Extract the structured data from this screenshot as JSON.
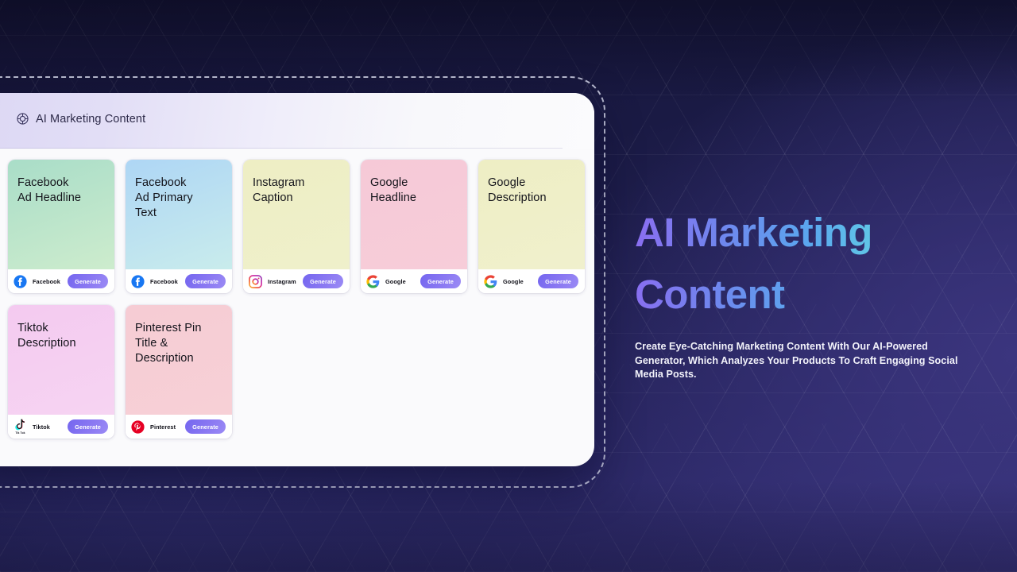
{
  "panel": {
    "header": {
      "icon": "target-circle-icon",
      "title": "AI Marketing Content"
    },
    "cards": [
      {
        "title": "Facebook\nAd Headline",
        "platform": "Facebook",
        "platform_icon": "facebook-icon",
        "button": "Generate",
        "swatch_from": "#a9ddc8",
        "swatch_to": "#cdeccd"
      },
      {
        "title": "Facebook\nAd Primary\nText",
        "platform": "Facebook",
        "platform_icon": "facebook-icon",
        "button": "Generate",
        "swatch_from": "#aed6f5",
        "swatch_to": "#c9ecec"
      },
      {
        "title": "Instagram\nCaption",
        "platform": "Instagram",
        "platform_icon": "instagram-icon",
        "button": "Generate",
        "swatch_from": "#eeeec4",
        "swatch_to": "#eff0cb"
      },
      {
        "title": "Google\nHeadline",
        "platform": "Google",
        "platform_icon": "google-icon",
        "button": "Generate",
        "swatch_from": "#f6c9d7",
        "swatch_to": "#f7cdd9"
      },
      {
        "title": "Google\nDescription",
        "platform": "Google",
        "platform_icon": "google-icon",
        "button": "Generate",
        "swatch_from": "#eeeec4",
        "swatch_to": "#f0f0cd"
      },
      {
        "title": "Tiktok\nDescription",
        "platform": "Tiktok",
        "platform_icon": "tiktok-icon",
        "button": "Generate",
        "swatch_from": "#f4caf0",
        "swatch_to": "#f6d4f2"
      },
      {
        "title": "Pinterest Pin\nTitle &\nDescription",
        "platform": "Pinterest",
        "platform_icon": "pinterest-icon",
        "button": "Generate",
        "swatch_from": "#f6ccd4",
        "swatch_to": "#f7d0d6"
      }
    ]
  },
  "hero": {
    "title": "AI Marketing\nContent",
    "body": "Create Eye-Catching Marketing Content With Our AI-Powered Generator, Which Analyzes Your Products To Craft Engaging Social Media Posts.",
    "title_gradient_start": "#8b6df0",
    "title_gradient_end": "#7ae0dc"
  },
  "theme": {
    "background_dark": "#161538",
    "background_accent": "#3a3580",
    "accent_purple": "#7466ef",
    "panel_background": "#fafafc"
  }
}
